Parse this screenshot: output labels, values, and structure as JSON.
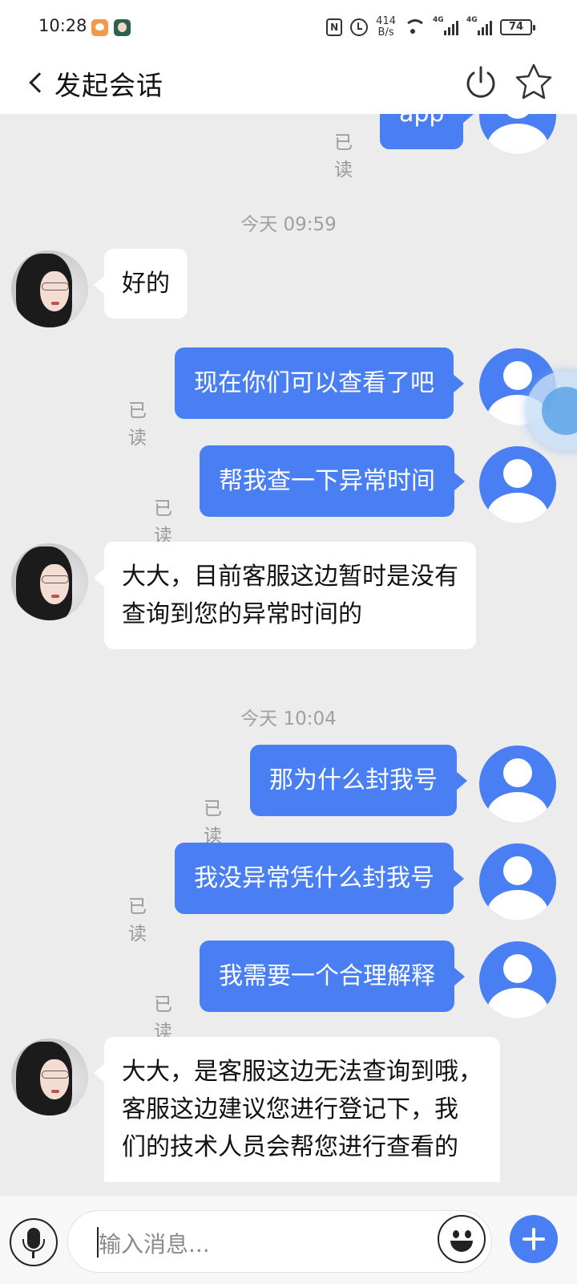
{
  "status_bar": {
    "time": "10:28",
    "network_speed_value": "414",
    "network_speed_unit": "B/s",
    "signal_1_tag": "4G",
    "signal_2_tag": "4G",
    "battery": "74"
  },
  "header": {
    "title": "发起会话"
  },
  "chat": {
    "read_label": "已读",
    "top_partial_message": "app",
    "timestamps": [
      "今天 09:59",
      "今天 10:04"
    ],
    "messages": [
      {
        "from": "agent",
        "text": "好的"
      },
      {
        "from": "user",
        "text": "现在你们可以查看了吧"
      },
      {
        "from": "user",
        "text": "帮我查一下异常时间"
      },
      {
        "from": "agent",
        "lines": [
          "大大，目前客服这边暂时是没有",
          "查询到您的异常时间的"
        ]
      },
      {
        "from": "user",
        "text": "那为什么封我号"
      },
      {
        "from": "user",
        "text": "我没异常凭什么封我号"
      },
      {
        "from": "user",
        "text": "我需要一个合理解释"
      },
      {
        "from": "agent",
        "lines": [
          "大大，是客服这边无法查询到哦，",
          "客服这边建议您进行登记下，我",
          "们的技术人员会帮您进行查看的"
        ]
      }
    ]
  },
  "input": {
    "placeholder": "输入消息..."
  },
  "colors": {
    "accent": "#4a7ff3",
    "chat_background": "#ececec",
    "read_label": "#9a9a9a"
  },
  "icons": [
    "back-icon",
    "power-icon",
    "star-icon",
    "microphone-icon",
    "emoji-icon",
    "plus-icon"
  ]
}
